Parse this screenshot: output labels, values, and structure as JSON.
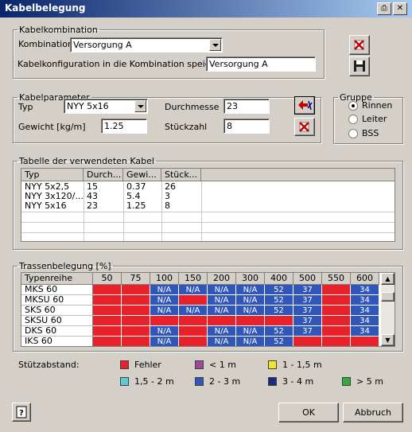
{
  "window": {
    "title": "Kabelbelegung"
  },
  "kombination": {
    "legend": "Kabelkombination",
    "label": "Kombination",
    "selected": "Versorgung A",
    "save_label": "Kabelkonfiguration in die Kombination speichern",
    "save_value": "Versorgung A"
  },
  "parameter": {
    "legend": "Kabelparameter",
    "typ_label": "Typ",
    "typ_value": "NYY  5x16",
    "durchmesser_label": "Durchmesse",
    "durchmesser_value": "23",
    "gewicht_label": "Gewicht [kg/m]",
    "gewicht_value": "1.25",
    "stueckzahl_label": "Stückzahl",
    "stueckzahl_value": "8"
  },
  "gruppe": {
    "legend": "Gruppe",
    "options": [
      "Rinnen",
      "Leiter",
      "BSS"
    ],
    "selected": 0
  },
  "tabelle": {
    "legend": "Tabelle der verwendeten Kabel",
    "headers": [
      "Typ",
      "Durch...",
      "Gewi...",
      "Stück..."
    ],
    "rows": [
      [
        "NYY  5x2,5",
        "15",
        "0.37",
        "26"
      ],
      [
        "NYY  3x120/...",
        "43",
        "5.4",
        "3"
      ],
      [
        "NYY  5x16",
        "23",
        "1.25",
        "8"
      ]
    ]
  },
  "trasse": {
    "legend": "Trassenbelegung [%]",
    "header_first": "Typenreihe",
    "columns": [
      "50",
      "75",
      "100",
      "150",
      "200",
      "300",
      "400",
      "500",
      "550",
      "600"
    ],
    "rows": [
      {
        "name": "MKS 60",
        "cells": [
          "r",
          "r",
          "b:N/A",
          "b:N/A",
          "b:N/A",
          "b:N/A",
          "b:52",
          "b:37",
          "r",
          "b:34"
        ]
      },
      {
        "name": "MKSU 60",
        "cells": [
          "r",
          "r",
          "b:N/A",
          "r",
          "b:N/A",
          "b:N/A",
          "b:52",
          "b:37",
          "r",
          "b:34"
        ]
      },
      {
        "name": "SKS 60",
        "cells": [
          "r",
          "r",
          "b:N/A",
          "b:N/A",
          "b:N/A",
          "b:N/A",
          "b:52",
          "b:37",
          "r",
          "b:34"
        ]
      },
      {
        "name": "SKSU 60",
        "cells": [
          "r",
          "r",
          "r",
          "r",
          "r",
          "r",
          "r",
          "b:37",
          "r",
          "b:34"
        ]
      },
      {
        "name": "DKS 60",
        "cells": [
          "r",
          "r",
          "b:N/A",
          "r",
          "b:N/A",
          "b:N/A",
          "b:52",
          "b:37",
          "r",
          "b:34"
        ]
      },
      {
        "name": "IKS 60",
        "cells": [
          "r",
          "r",
          "b:N/A",
          "r",
          "b:N/A",
          "b:N/A",
          "b:52",
          "r",
          "r",
          "r"
        ]
      }
    ]
  },
  "stuetzabstand": {
    "label": "Stützabstand:",
    "items": [
      {
        "label": "Fehler",
        "color": "#e8222a"
      },
      {
        "label": "< 1 m",
        "color": "#9b4b9b"
      },
      {
        "label": "1 - 1,5 m",
        "color": "#f0e62c"
      },
      {
        "label": "1,5 - 2 m",
        "color": "#5ec7d8"
      },
      {
        "label": "2 - 3 m",
        "color": "#2f56b8"
      },
      {
        "label": "3 - 4 m",
        "color": "#1b2a7a"
      },
      {
        "label": "> 5 m",
        "color": "#3aa83a"
      }
    ]
  },
  "buttons": {
    "ok": "OK",
    "abbruch": "Abbruch"
  },
  "icons": {
    "delete_combination": "delete-icon",
    "save_combination": "floppy-disk-icon",
    "add_cable": "add-cable-icon",
    "remove_cable": "delete-icon",
    "help": "help-icon",
    "print": "printer-icon",
    "close": "close-icon"
  },
  "colors": {
    "red": "#e8222a",
    "blue": "#2f56b8",
    "dark_blue": "#1b2a7a"
  }
}
